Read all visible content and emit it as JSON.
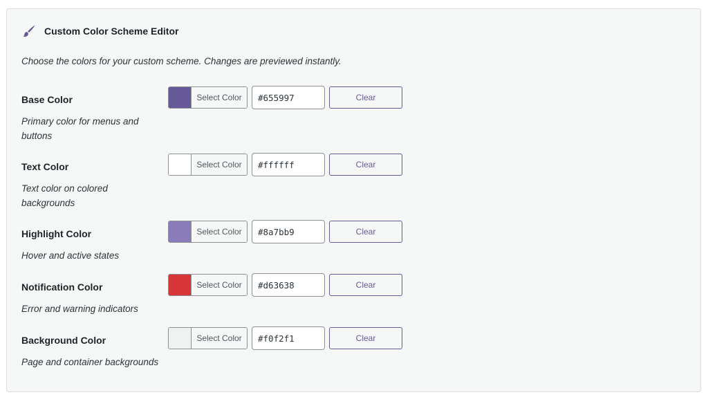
{
  "header": {
    "icon": "paintbrush-icon",
    "title": "Custom Color Scheme Editor"
  },
  "intro": "Choose the colors for your custom scheme. Changes are previewed instantly.",
  "rows": [
    {
      "title": "Base Color",
      "description": "Primary color for menus and buttons",
      "swatch": "#655997",
      "select_label": "Select Color",
      "value": "#655997",
      "clear_label": "Clear"
    },
    {
      "title": "Text Color",
      "description": "Text color on colored backgrounds",
      "swatch": "#ffffff",
      "select_label": "Select Color",
      "value": "#ffffff",
      "clear_label": "Clear"
    },
    {
      "title": "Highlight Color",
      "description": "Hover and active states",
      "swatch": "#8a7bb9",
      "select_label": "Select Color",
      "value": "#8a7bb9",
      "clear_label": "Clear"
    },
    {
      "title": "Notification Color",
      "description": "Error and warning indicators",
      "swatch": "#d63638",
      "select_label": "Select Color",
      "value": "#d63638",
      "clear_label": "Clear"
    },
    {
      "title": "Background Color",
      "description": "Page and container backgrounds",
      "swatch": "#f0f2f1",
      "select_label": "Select Color",
      "value": "#f0f2f1",
      "clear_label": "Clear"
    }
  ],
  "colors": {
    "accent": "#655997",
    "panel_background": "#f6f7f7"
  }
}
